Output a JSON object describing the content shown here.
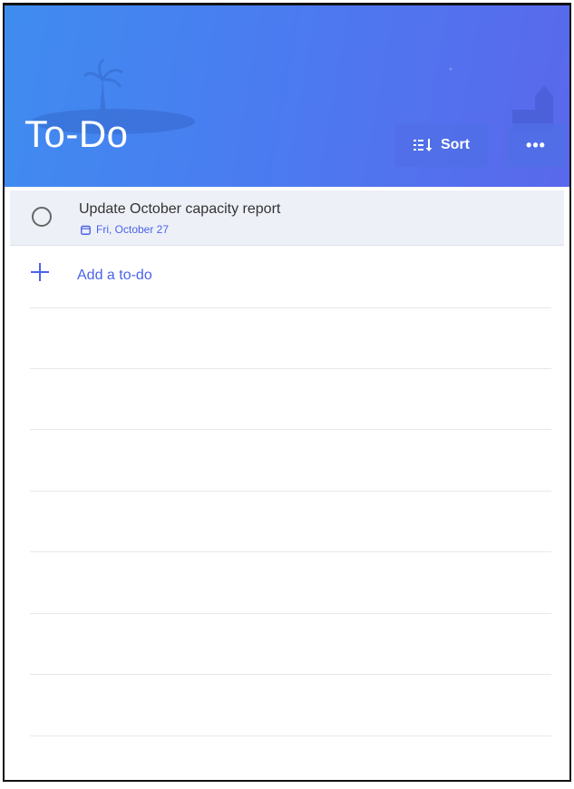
{
  "header": {
    "title": "To-Do",
    "sort_label": "Sort",
    "more_label": "•••",
    "gradient_start": "#3f8cf0",
    "gradient_end": "#5a68ec"
  },
  "tasks": [
    {
      "title": "Update October capacity report",
      "due": "Fri, October 27",
      "completed": false,
      "icon": "calendar-icon"
    }
  ],
  "add_todo": {
    "label": "Add a to-do",
    "icon": "plus-icon"
  },
  "colors": {
    "accent": "#4a63e8",
    "task_bg": "#eef0f8"
  }
}
